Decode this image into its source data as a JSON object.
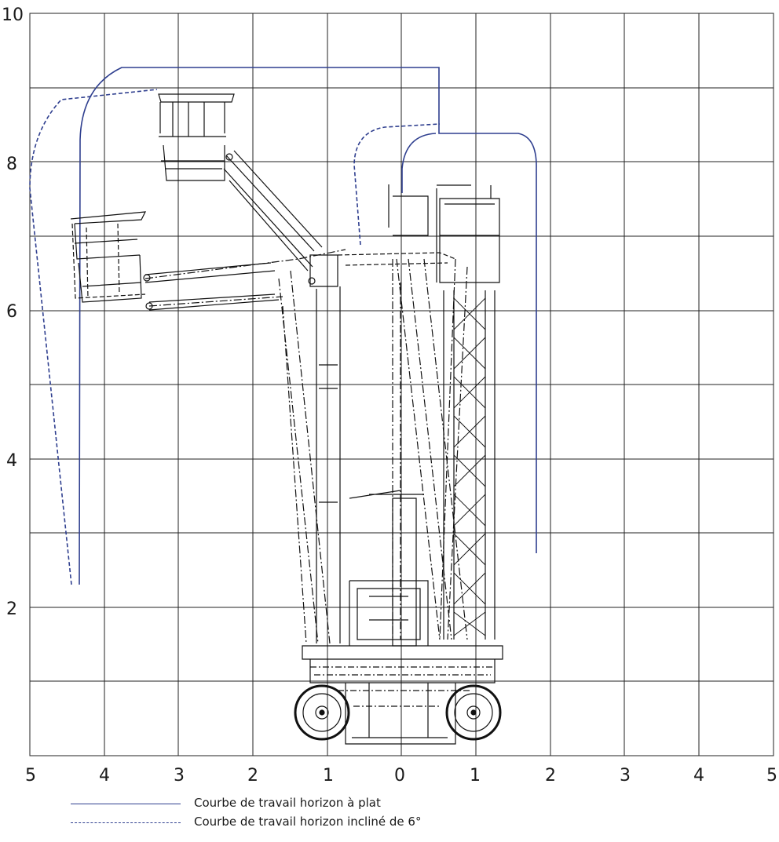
{
  "grid": {
    "y_ticks": [
      "10",
      "8",
      "6",
      "4",
      "2"
    ],
    "x_ticks": [
      "5",
      "4",
      "3",
      "2",
      "1",
      "0",
      "1",
      "2",
      "3",
      "4",
      "5"
    ]
  },
  "legend": {
    "flat": "Courbe de travail horizon à plat",
    "inclined": "Courbe de travail horizon incliné de 6°"
  },
  "colors": {
    "curve": "#2f3f8f",
    "grid": "#222222",
    "machine": "#111111"
  },
  "icons": {
    "machine": "aerial-work-platform-drawing"
  }
}
